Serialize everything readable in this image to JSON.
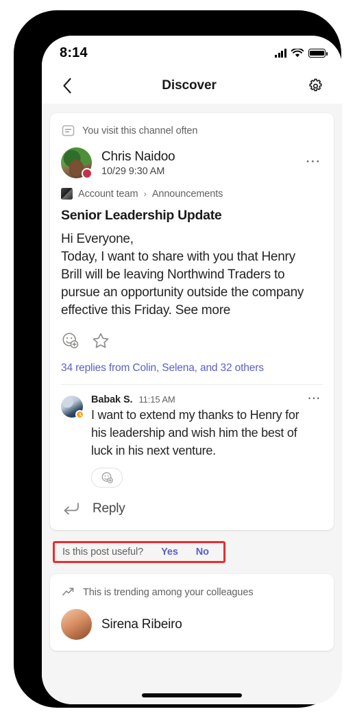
{
  "status_bar": {
    "time": "8:14",
    "icons": [
      "signal-icon",
      "wifi-icon",
      "battery-icon"
    ]
  },
  "header": {
    "back_icon": "chevron-left-icon",
    "title": "Discover",
    "settings_icon": "gear-icon"
  },
  "feed": {
    "post_card": {
      "reason": {
        "icon": "channel-feed-icon",
        "text": "You visit this channel often"
      },
      "author": {
        "name": "Chris Naidoo",
        "timestamp": "10/29 9:30 AM",
        "presence": "busy",
        "presence_color": "#c4314b",
        "more_icon": "more-options-icon"
      },
      "breadcrumb": {
        "team": "Account team",
        "separator": "›",
        "channel": "Announcements"
      },
      "title": "Senior Leadership Update",
      "body": "Hi Everyone,\nToday, I want to share with you that Henry Brill will be leaving Northwind Traders to pursue an opportunity outside the company effective this Friday. See more",
      "actions": {
        "react_icon": "add-reaction-icon",
        "save_icon": "star-icon"
      },
      "replies_link": "34 replies from Colin, Selena, and 32 others",
      "reply": {
        "name": "Babak S.",
        "timestamp": "11:15 AM",
        "presence": "away",
        "presence_color": "#f5a623",
        "text": "I want to extend my thanks to Henry for his leadership and wish him the best of luck in his next venture.",
        "react_icon": "add-reaction-icon",
        "more_icon": "more-options-icon"
      },
      "reply_action": {
        "icon": "reply-arrow-icon",
        "label": "Reply"
      }
    },
    "feedback": {
      "question": "Is this post useful?",
      "yes_label": "Yes",
      "no_label": "No",
      "link_color": "#5b5fc7",
      "highlight_color": "#ee2b2b"
    },
    "trending_card": {
      "reason": {
        "icon": "trending-arrow-icon",
        "text": "This is trending among your colleagues"
      },
      "author": {
        "name": "Sirena Ribeiro"
      }
    }
  }
}
